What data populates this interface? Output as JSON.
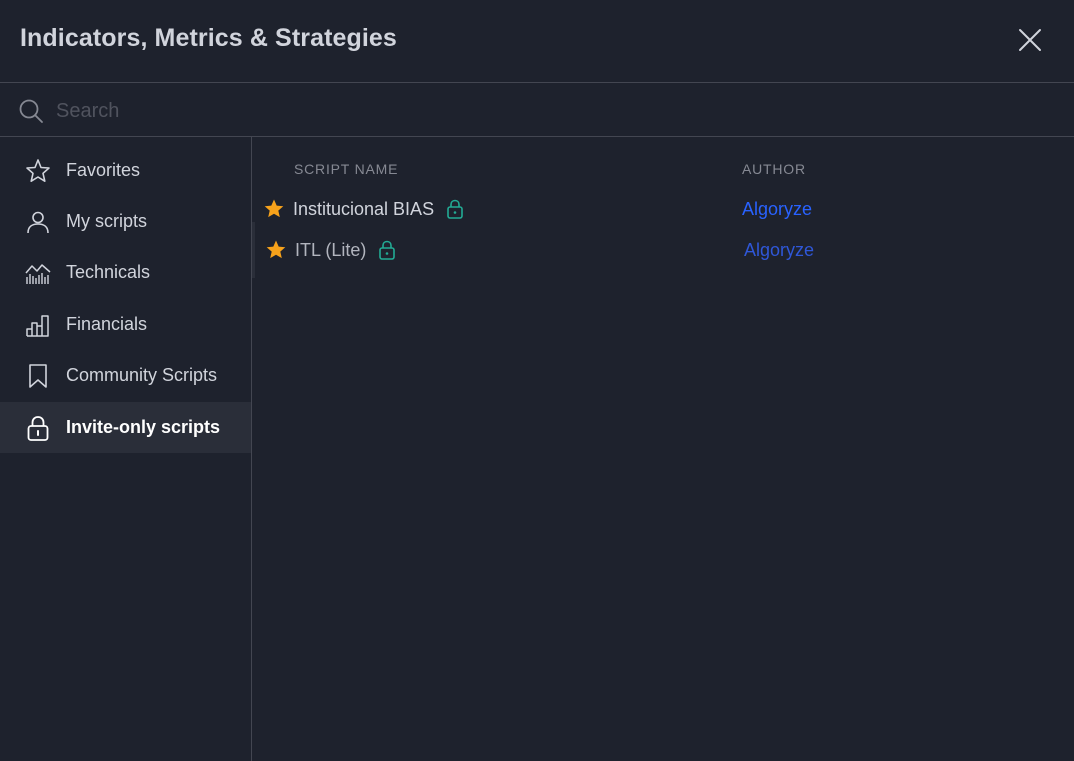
{
  "dialog": {
    "title": "Indicators, Metrics & Strategies",
    "close_icon": "close-icon"
  },
  "search": {
    "placeholder": "Search",
    "value": "",
    "icon": "search-icon"
  },
  "sidebar": {
    "items": [
      {
        "label": "Favorites",
        "icon": "star-outline-icon",
        "active": false
      },
      {
        "label": "My scripts",
        "icon": "user-icon",
        "active": false
      },
      {
        "label": "Technicals",
        "icon": "technicals-chart-icon",
        "active": false
      },
      {
        "label": "Financials",
        "icon": "bar-chart-icon",
        "active": false
      },
      {
        "label": "Community Scripts",
        "icon": "bookmark-icon",
        "active": false
      },
      {
        "label": "Invite-only scripts",
        "icon": "lock-icon",
        "active": true
      }
    ]
  },
  "table": {
    "headers": {
      "name": "SCRIPT NAME",
      "author": "AUTHOR"
    },
    "rows": [
      {
        "name": "Institucional BIAS",
        "author": "Algoryze",
        "favorite": true,
        "locked": true
      },
      {
        "name": "ITL (Lite)",
        "author": "Algoryze",
        "favorite": true,
        "locked": true
      }
    ]
  },
  "colors": {
    "background": "#1e222d",
    "text": "#d1d4dc",
    "muted": "#868993",
    "border": "#434651",
    "active_bg": "#2a2e39",
    "accent_link": "#2962ff",
    "star": "#f7a21b",
    "lock": "#22ab94"
  }
}
